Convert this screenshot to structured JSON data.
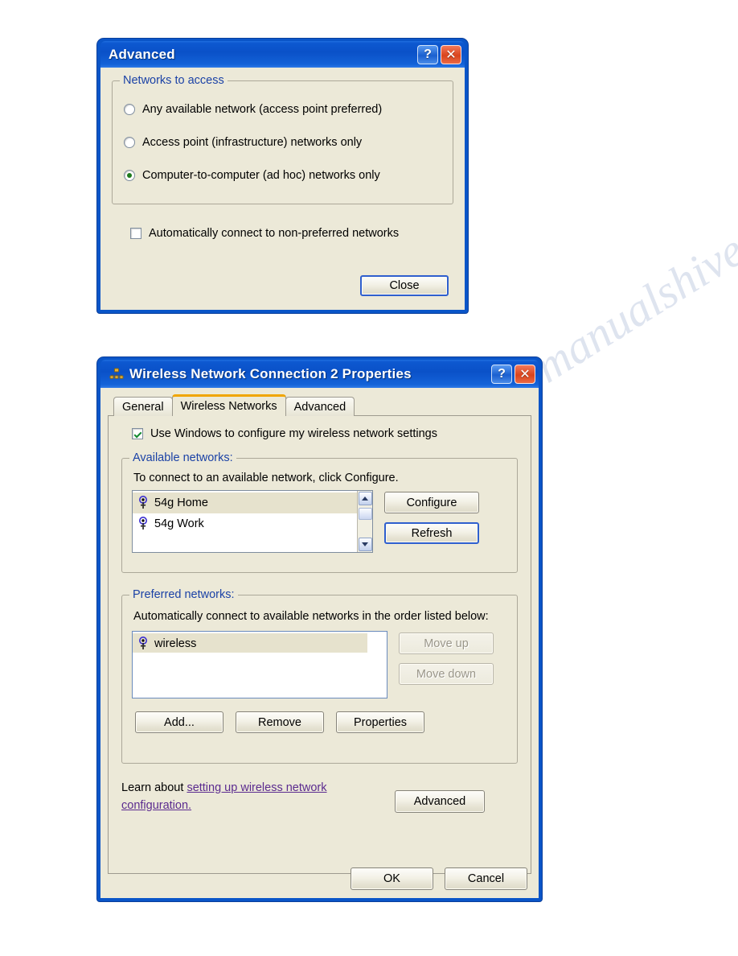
{
  "advanced_dialog": {
    "title": "Advanced",
    "help_button": "?",
    "close_button": "✕",
    "group_networks_to_access": {
      "legend": "Networks to access",
      "options": [
        {
          "label": "Any available network (access point preferred)",
          "selected": false
        },
        {
          "label": "Access point (infrastructure) networks only",
          "selected": false
        },
        {
          "label": "Computer-to-computer (ad hoc) networks only",
          "selected": true
        }
      ]
    },
    "auto_connect_checkbox": {
      "label": "Automatically connect to non-preferred networks",
      "checked": false
    },
    "close_label": "Close"
  },
  "properties_dialog": {
    "title": "Wireless Network Connection 2 Properties",
    "title_icon": "network-connection-icon",
    "help_button": "?",
    "close_button": "✕",
    "tabs": [
      {
        "label": "General",
        "active": false
      },
      {
        "label": "Wireless Networks",
        "active": true
      },
      {
        "label": "Advanced",
        "active": false
      }
    ],
    "use_windows_checkbox": {
      "label": "Use Windows to configure my wireless network settings",
      "checked": true
    },
    "available_networks": {
      "legend": "Available networks:",
      "description": "To connect to an available network, click Configure.",
      "items": [
        {
          "name": "54g Home",
          "icon": "wireless-signal-icon",
          "selected": true
        },
        {
          "name": "54g Work",
          "icon": "wireless-signal-icon",
          "selected": false
        }
      ],
      "buttons": [
        {
          "label": "Configure",
          "focused": false,
          "disabled": false
        },
        {
          "label": "Refresh",
          "focused": true,
          "disabled": false
        }
      ]
    },
    "preferred_networks": {
      "legend": "Preferred networks:",
      "description": "Automatically connect to available networks in the order listed below:",
      "items": [
        {
          "name": "wireless",
          "icon": "wireless-signal-icon",
          "selected": true
        }
      ],
      "side_buttons": [
        {
          "label": "Move up",
          "disabled": true
        },
        {
          "label": "Move down",
          "disabled": true
        }
      ],
      "bottom_buttons": [
        {
          "label": "Add...",
          "disabled": false
        },
        {
          "label": "Remove",
          "disabled": false
        },
        {
          "label": "Properties",
          "disabled": false
        }
      ]
    },
    "learn": {
      "prefix": "Learn about ",
      "link": "setting up wireless network configuration.",
      "advanced_label": "Advanced"
    },
    "footer": {
      "ok_label": "OK",
      "cancel_label": "Cancel"
    }
  },
  "watermark": {
    "line1": "manualshive.com"
  },
  "colors": {
    "title_blue": "#0A51C8",
    "client_bg": "#ECE9D8",
    "legend_blue": "#1B42A6",
    "link_purple": "#5B2B8F",
    "tab_accent_orange": "#F0A500",
    "radio_green": "#1D7A1D",
    "selection_bg": "#E6E2CD"
  }
}
